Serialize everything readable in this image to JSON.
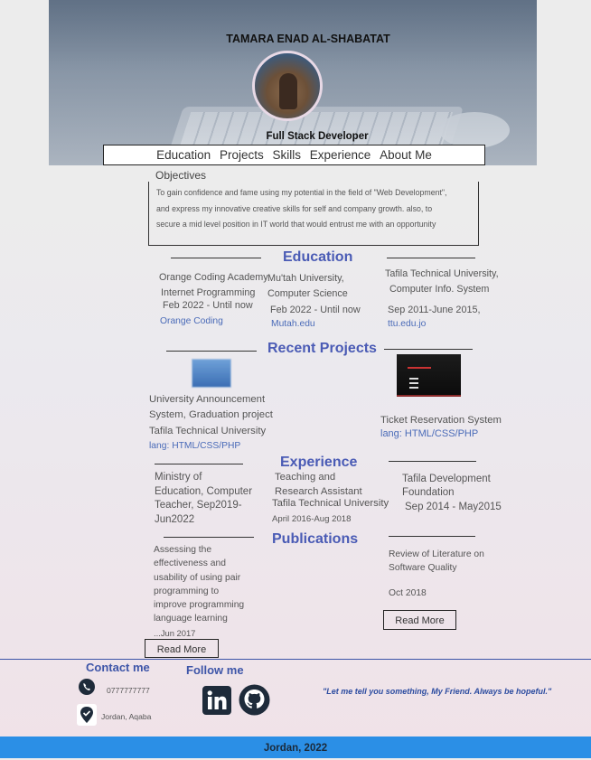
{
  "header": {
    "name": "TAMARA ENAD AL-SHABATAT",
    "role": "Full Stack Developer"
  },
  "nav": [
    "Education",
    "Projects",
    "Skills",
    "Experience",
    "About Me"
  ],
  "objectives": {
    "label": "Objectives",
    "lines": [
      "To gain confidence and fame using my potential in the field of \"Web Development\",",
      "and express my innovative creative skills for self and company growth. also, to",
      "secure a mid level position in IT world that would entrust me with an opportunity"
    ]
  },
  "education": {
    "title": "Education",
    "items": [
      {
        "line1": "Orange Coding Academy",
        "line2": "Internet Programming",
        "line3": "Feb 2022 - Until now",
        "link": "Orange Coding"
      },
      {
        "line1": "Mu'tah University,",
        "line2": "Computer Science",
        "line3": "Feb 2022 - Until now",
        "link": "Mutah.edu"
      },
      {
        "line1": "Tafila Technical University,",
        "line2": "Computer Info. System",
        "line3": "Sep 2011-June 2015,",
        "link": "ttu.edu.jo"
      }
    ]
  },
  "projects": {
    "title": "Recent Projects",
    "items": [
      {
        "line1": "University Announcement",
        "line2": "System, Graduation project",
        "line3": "Tafila Technical University",
        "lang": "lang: HTML/CSS/PHP"
      },
      {
        "line1": "Ticket Reservation System",
        "lang": "lang: HTML/CSS/PHP"
      }
    ]
  },
  "experience": {
    "title": "Experience",
    "items": [
      {
        "line1": "Ministry of",
        "line2": "Education, Computer",
        "line3": "Teacher, Sep2019-",
        "line4": "Jun2022"
      },
      {
        "line1": "Teaching and",
        "line2": "Research Assistant",
        "line3": "Tafila Technical University",
        "line4": "April 2016-Aug 2018"
      },
      {
        "line1": "Tafila Development",
        "line2": "Foundation",
        "line3": "Sep 2014 - May2015"
      }
    ]
  },
  "publications": {
    "title": "Publications",
    "items": [
      {
        "lines": [
          "Assessing the",
          "effectiveness and",
          "usability of using pair",
          "programming to",
          "improve programming",
          "language learning"
        ],
        "date": "...Jun 2017",
        "button": "Read More"
      },
      {
        "lines": [
          "Review of Literature on",
          "Software Quality"
        ],
        "date": "Oct 2018",
        "button": "Read More"
      }
    ]
  },
  "contact": {
    "title": "Contact me",
    "phone": "0777777777",
    "location": "Jordan, Aqaba"
  },
  "follow": {
    "title": "Follow  me",
    "icons": [
      "linkedin-icon",
      "github-icon"
    ]
  },
  "quote": "\"Let me tell you something, My Friend. Always be hopeful.\"",
  "footer": {
    "text": "Jordan, 2022"
  },
  "colors": {
    "accent": "#4a5bb5",
    "footer_bar": "#2b8fe6",
    "link": "#4a6bb8"
  }
}
